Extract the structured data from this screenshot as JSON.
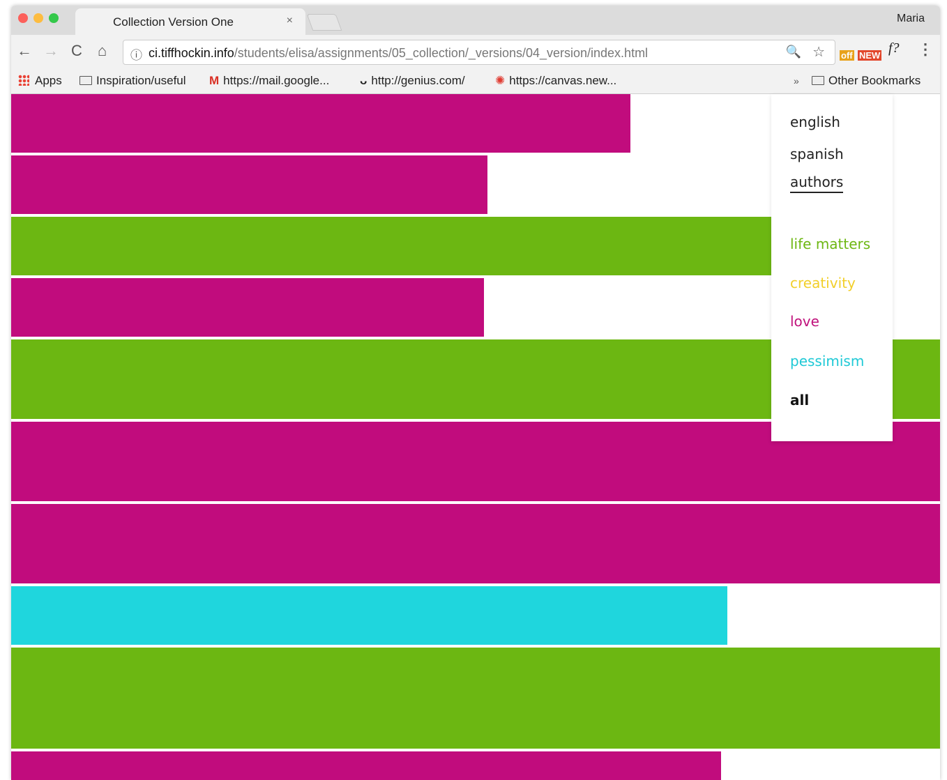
{
  "browser": {
    "tab_title": "Collection Version One",
    "tab_close": "×",
    "profile_name": "Maria",
    "nav": {
      "back": "←",
      "forward": "→",
      "reload": "C",
      "home": "⌂"
    },
    "url_host": "ci.tiffhockin.info",
    "url_path": "/students/elisa/assignments/05_collection/_versions/04_version/index.html",
    "icons": {
      "info": "ⓘ",
      "zoom": "🔍",
      "star": "☆",
      "ext_off": "off",
      "ext_new": "NEW",
      "ext_f": "f?",
      "menu": "⋮"
    }
  },
  "bookmarks": {
    "items": [
      {
        "label": "Apps",
        "icon": "apps-grid-icon"
      },
      {
        "label": "Inspiration/useful",
        "icon": "folder-icon"
      },
      {
        "label": "https://mail.google...",
        "icon": "gmail-icon",
        "glyph": "M"
      },
      {
        "label": "http://genius.com/",
        "icon": "genius-icon",
        "glyph": "ᴗ"
      },
      {
        "label": "https://canvas.new...",
        "icon": "canvas-icon",
        "glyph": "✺"
      }
    ],
    "overflow": "»",
    "other": "Other Bookmarks"
  },
  "menu": {
    "items": [
      "english",
      "spanish",
      "authors"
    ],
    "filters": [
      {
        "label": "life matters",
        "color": "#6db712"
      },
      {
        "label": "creativity",
        "color": "#f2cf2a"
      },
      {
        "label": "love",
        "color": "#c0127c"
      },
      {
        "label": "pessimism",
        "color": "#1fc9d6"
      },
      {
        "label": "all",
        "color": "#111111"
      }
    ]
  },
  "colors": {
    "magenta": "#c10c7d",
    "green": "#6cb712",
    "cyan": "#1fd6dd"
  },
  "bars": [
    {
      "category": "love",
      "fill": 0.667
    },
    {
      "category": "love",
      "fill": 0.513
    },
    {
      "category": "life matters",
      "fill": 0.818
    },
    {
      "category": "love",
      "fill": 0.509
    },
    {
      "category": "life matters",
      "fill": 1.0
    },
    {
      "category": "love",
      "fill": 1.0
    },
    {
      "category": "love",
      "fill": 1.0
    },
    {
      "category": "pessimism",
      "fill": 0.771
    },
    {
      "category": "life matters",
      "fill": 1.0
    },
    {
      "category": "love",
      "fill": 0.764
    }
  ]
}
